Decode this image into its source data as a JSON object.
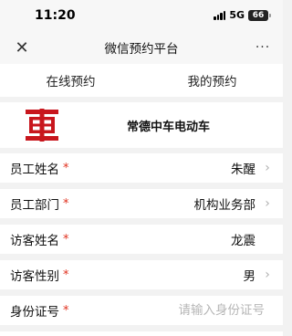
{
  "status_bar": {
    "time": "11:20",
    "network": "5G",
    "battery": "66"
  },
  "nav": {
    "close_icon": "close-icon",
    "title": "微信预约平台",
    "more_icon": "more-icon",
    "more_glyph": "···"
  },
  "tabs": [
    {
      "label": "在线预约"
    },
    {
      "label": "我的预约"
    }
  ],
  "company": {
    "logo": "crrc-logo",
    "logo_color": "#c8161d",
    "name": "常德中车电动车"
  },
  "form": {
    "required_mark": "*",
    "fields": [
      {
        "label": "员工姓名",
        "value": "朱醒",
        "has_chevron": true
      },
      {
        "label": "员工部门",
        "value": "机构业务部",
        "has_chevron": true
      },
      {
        "label": "访客姓名",
        "value": "龙震",
        "has_chevron": false
      },
      {
        "label": "访客性别",
        "value": "男",
        "has_chevron": true
      },
      {
        "label": "身份证号",
        "value": "",
        "placeholder": "请输入身份证号",
        "has_chevron": false
      }
    ]
  },
  "colors": {
    "required": "#e0301e",
    "background": "#f2f2f2",
    "placeholder": "#b6b6b6"
  }
}
